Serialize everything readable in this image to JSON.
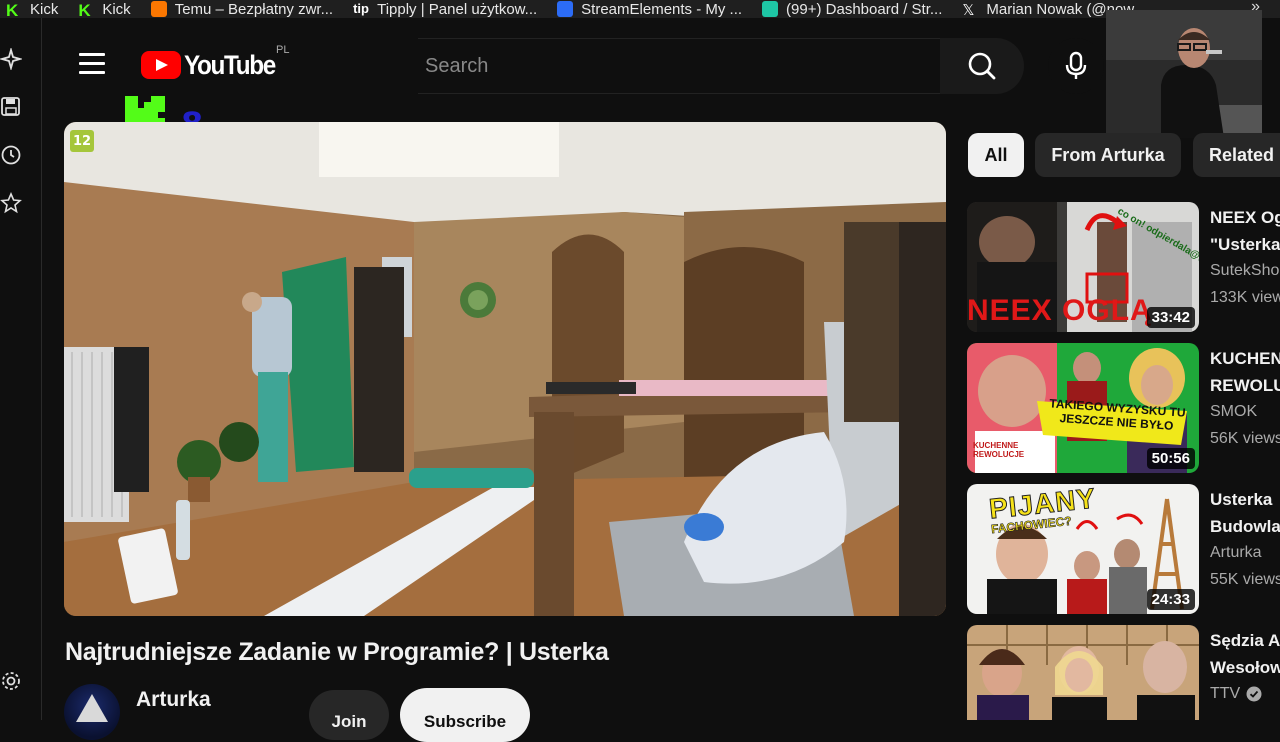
{
  "bookmarks": [
    {
      "label": "Kick",
      "icon": "kick-icon"
    },
    {
      "label": "Kick",
      "icon": "kick-icon"
    },
    {
      "label": "Temu – Bezpłatny zwr...",
      "icon": "temu-icon"
    },
    {
      "label": "Tipply | Panel użytkow...",
      "icon": "tipply-icon"
    },
    {
      "label": "StreamElements - My ...",
      "icon": "streamelements-icon"
    },
    {
      "label": "(99+) Dashboard / Str...",
      "icon": "twitch-icon"
    },
    {
      "label": "Marian Nowak (@now...",
      "icon": "x-icon"
    }
  ],
  "header": {
    "logo_text": "YouTube",
    "country_code": "PL",
    "search_placeholder": "Search"
  },
  "overlay": {
    "kick_number": "8"
  },
  "player": {
    "age_rating": "12"
  },
  "video": {
    "title": "Najtrudniejsze Zadanie w Programie? | Usterka",
    "channel": "Arturka",
    "join_label": "Join",
    "subscribe_label": "Subscribe"
  },
  "chips": [
    "All",
    "From Arturka",
    "Related"
  ],
  "recommendations": [
    {
      "title_line1": "NEEX Og",
      "title_line2": "\"Usterka",
      "channel": "SutekSho",
      "views": "133K view",
      "duration": "33:42",
      "thumb_text": "NEEX OGLĄ",
      "thumb_note": "co on! odpierdala@@"
    },
    {
      "title_line1": "KUCHEN",
      "title_line2": "REWOLU",
      "channel": "SMOK",
      "views": "56K views",
      "duration": "50:56",
      "thumb_text": "TAKIEGO WYZYSKU TU JESZCZE NIE BYŁO",
      "thumb_note": "KUCHENNE REWOLUCJE"
    },
    {
      "title_line1": "Usterka",
      "title_line2": "Budowla",
      "channel": "Arturka",
      "views": "55K views",
      "duration": "24:33",
      "thumb_text": "PIJANY",
      "thumb_note": "FACHOWIEC?"
    },
    {
      "title_line1": "Sędzia A",
      "title_line2": "Wesołow",
      "channel": "TTV",
      "views": "",
      "duration": "",
      "thumb_text": "",
      "thumb_note": ""
    }
  ],
  "colors": {
    "yt_red": "#ff0000",
    "kick_green": "#53fc18",
    "background": "#0f0f0f"
  }
}
